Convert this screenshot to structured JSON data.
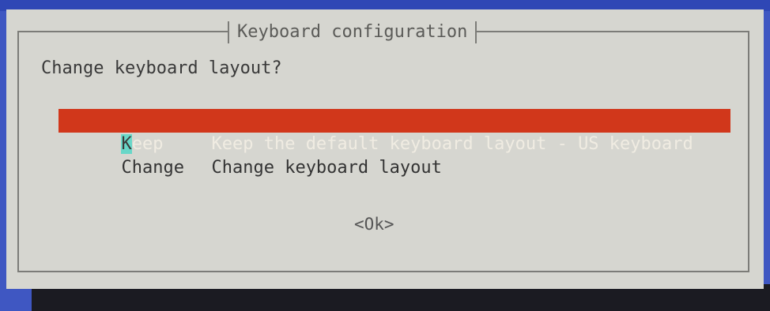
{
  "dialog": {
    "title": "Keyboard configuration",
    "prompt": "Change keyboard layout?",
    "options": [
      {
        "tag_cursor": "K",
        "tag_rest": "eep",
        "description": "Keep the default keyboard layout - US keyboard"
      },
      {
        "tag": "Change",
        "description": "Change keyboard layout"
      }
    ],
    "ok_label": "<Ok>"
  },
  "colors": {
    "screen_background": "#3f57c2",
    "dialog_background": "#d6d6d0",
    "selected_item": "#d1371b",
    "cursor": "#69d7c8",
    "border": "#7c7c78"
  }
}
